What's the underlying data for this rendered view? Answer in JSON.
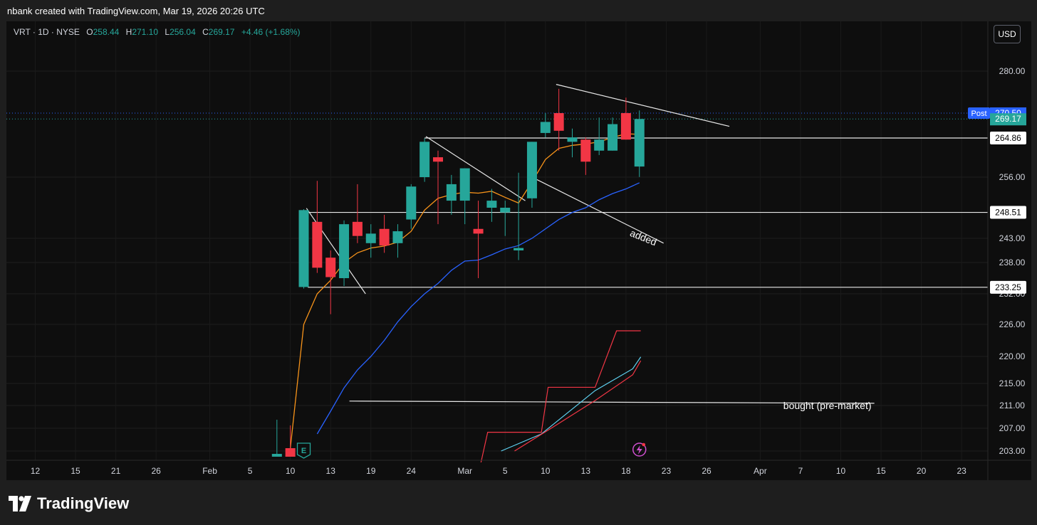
{
  "header": {
    "credit": "nbank created with TradingView.com, Mar 19, 2026 20:26 UTC"
  },
  "legend": {
    "symbol": "VRT · 1D · NYSE",
    "o_label": "O",
    "o_value": "258.44",
    "h_label": "H",
    "h_value": "271.10",
    "l_label": "L",
    "l_value": "256.04",
    "c_label": "C",
    "c_value": "269.17",
    "change": "+4.46 (+1.68%)"
  },
  "currency_button": "USD",
  "footer": {
    "brand": "TradingView"
  },
  "colors": {
    "up": "#26a69a",
    "down": "#f23645",
    "ema_fast": "#f7931a",
    "ema_slow": "#2962ff",
    "post_badge": "#2962ff",
    "trail_red": "#f23645",
    "trail_cyan": "#5fd3f3"
  },
  "icons": {
    "earnings": "earnings-e-icon",
    "flash": "lightning-icon",
    "logo": "tradingview-logo-icon"
  },
  "chart_data": {
    "type": "candlestick",
    "symbol": "VRT",
    "interval": "1D",
    "exchange": "NYSE",
    "ylim": [
      202,
      285
    ],
    "y_ticks": [
      "280.00",
      "256.00",
      "243.00",
      "238.00",
      "232.00",
      "226.00",
      "220.00",
      "215.00",
      "211.00",
      "207.00",
      "203.00"
    ],
    "y_tick_values": [
      280,
      256,
      243,
      238,
      232,
      226,
      220,
      215,
      211,
      207,
      203
    ],
    "x_ticks": [
      {
        "label": "12",
        "slot": 0
      },
      {
        "label": "15",
        "slot": 3
      },
      {
        "label": "21",
        "slot": 6
      },
      {
        "label": "26",
        "slot": 9
      },
      {
        "label": "Feb",
        "slot": 13
      },
      {
        "label": "5",
        "slot": 16
      },
      {
        "label": "10",
        "slot": 19
      },
      {
        "label": "13",
        "slot": 22
      },
      {
        "label": "19",
        "slot": 25
      },
      {
        "label": "24",
        "slot": 28
      },
      {
        "label": "Mar",
        "slot": 32
      },
      {
        "label": "5",
        "slot": 35
      },
      {
        "label": "10",
        "slot": 38
      },
      {
        "label": "13",
        "slot": 41
      },
      {
        "label": "18",
        "slot": 44
      },
      {
        "label": "23",
        "slot": 47
      },
      {
        "label": "26",
        "slot": 50
      },
      {
        "label": "Apr",
        "slot": 54
      },
      {
        "label": "7",
        "slot": 57
      },
      {
        "label": "10",
        "slot": 60
      },
      {
        "label": "15",
        "slot": 63
      },
      {
        "label": "20",
        "slot": 66
      },
      {
        "label": "23",
        "slot": 69
      }
    ],
    "candles": [
      {
        "slot": 18,
        "o": 202.0,
        "h": 208.5,
        "l": 202.0,
        "c": 202.5
      },
      {
        "slot": 19,
        "o": 203.5,
        "h": 207.5,
        "l": 202.0,
        "c": 202.0
      },
      {
        "slot": 20,
        "o": 233.3,
        "h": 249.2,
        "l": 233.0,
        "c": 249.0
      },
      {
        "slot": 21,
        "o": 246.5,
        "h": 255.2,
        "l": 236.0,
        "c": 237.0
      },
      {
        "slot": 22,
        "o": 239.0,
        "h": 240.5,
        "l": 228.0,
        "c": 235.2
      },
      {
        "slot": 23,
        "o": 235.0,
        "h": 246.8,
        "l": 233.5,
        "c": 246.0
      },
      {
        "slot": 24,
        "o": 246.5,
        "h": 254.5,
        "l": 242.0,
        "c": 243.5
      },
      {
        "slot": 25,
        "o": 242.0,
        "h": 246.0,
        "l": 239.0,
        "c": 244.0
      },
      {
        "slot": 26,
        "o": 245.0,
        "h": 248.0,
        "l": 240.0,
        "c": 241.5
      },
      {
        "slot": 27,
        "o": 242.0,
        "h": 246.0,
        "l": 239.0,
        "c": 244.5
      },
      {
        "slot": 28,
        "o": 247.0,
        "h": 254.5,
        "l": 245.0,
        "c": 254.0
      },
      {
        "slot": 29,
        "o": 256.0,
        "h": 264.8,
        "l": 255.0,
        "c": 264.0
      },
      {
        "slot": 30,
        "o": 260.5,
        "h": 262.0,
        "l": 246.0,
        "c": 259.5
      },
      {
        "slot": 31,
        "o": 251.0,
        "h": 256.5,
        "l": 248.0,
        "c": 254.5
      },
      {
        "slot": 32,
        "o": 251.0,
        "h": 258.0,
        "l": 246.0,
        "c": 258.0
      },
      {
        "slot": 33,
        "o": 245.0,
        "h": 251.0,
        "l": 235.0,
        "c": 244.0
      },
      {
        "slot": 34,
        "o": 249.5,
        "h": 253.5,
        "l": 246.5,
        "c": 251.0
      },
      {
        "slot": 35,
        "o": 248.5,
        "h": 251.0,
        "l": 243.5,
        "c": 249.5
      },
      {
        "slot": 36,
        "o": 240.5,
        "h": 257.0,
        "l": 238.5,
        "c": 241.0
      },
      {
        "slot": 37,
        "o": 251.5,
        "h": 264.0,
        "l": 249.5,
        "c": 264.0
      },
      {
        "slot": 38,
        "o": 266.0,
        "h": 270.5,
        "l": 265.0,
        "c": 268.5
      },
      {
        "slot": 39,
        "o": 270.5,
        "h": 276.0,
        "l": 262.0,
        "c": 266.5
      },
      {
        "slot": 40,
        "o": 264.0,
        "h": 267.0,
        "l": 260.5,
        "c": 265.0
      },
      {
        "slot": 41,
        "o": 264.5,
        "h": 265.0,
        "l": 256.5,
        "c": 259.5
      },
      {
        "slot": 42,
        "o": 262.0,
        "h": 269.5,
        "l": 261.0,
        "c": 264.5
      },
      {
        "slot": 43,
        "o": 262.0,
        "h": 269.5,
        "l": 262.0,
        "c": 268.0
      },
      {
        "slot": 44,
        "o": 270.5,
        "h": 274.0,
        "l": 264.5,
        "c": 264.5
      },
      {
        "slot": 45,
        "o": 258.4,
        "h": 271.1,
        "l": 256.04,
        "c": 269.17
      }
    ],
    "ema_fast": [
      [
        19,
        203.5
      ],
      [
        20,
        226.0
      ],
      [
        21,
        232.0
      ],
      [
        22,
        234.6
      ],
      [
        23,
        238.0
      ],
      [
        24,
        240.0
      ],
      [
        25,
        241.0
      ],
      [
        26,
        241.4
      ],
      [
        27,
        242.2
      ],
      [
        28,
        244.5
      ],
      [
        29,
        249.0
      ],
      [
        30,
        251.5
      ],
      [
        31,
        252.3
      ],
      [
        32,
        252.8
      ],
      [
        33,
        252.6
      ],
      [
        34,
        253.0
      ],
      [
        35,
        251.7
      ],
      [
        36,
        250.5
      ],
      [
        37,
        255.0
      ],
      [
        38,
        260.0
      ],
      [
        39,
        262.5
      ],
      [
        40,
        263.2
      ],
      [
        41,
        263.5
      ],
      [
        42,
        264.0
      ],
      [
        43,
        265.0
      ],
      [
        44,
        265.8
      ],
      [
        45,
        265.7
      ]
    ],
    "ema_slow": [
      [
        21,
        206.0
      ],
      [
        22,
        210.0
      ],
      [
        23,
        214.2
      ],
      [
        24,
        217.5
      ],
      [
        25,
        220.0
      ],
      [
        26,
        223.0
      ],
      [
        27,
        226.5
      ],
      [
        28,
        229.5
      ],
      [
        29,
        232.0
      ],
      [
        30,
        234.0
      ],
      [
        31,
        236.5
      ],
      [
        32,
        238.3
      ],
      [
        33,
        238.5
      ],
      [
        34,
        239.6
      ],
      [
        35,
        240.8
      ],
      [
        36,
        241.5
      ],
      [
        37,
        243.0
      ],
      [
        38,
        245.0
      ],
      [
        39,
        247.0
      ],
      [
        40,
        248.5
      ],
      [
        41,
        249.5
      ],
      [
        42,
        251.2
      ],
      [
        43,
        252.5
      ],
      [
        44,
        253.5
      ],
      [
        45,
        254.8
      ]
    ],
    "horizontal_levels": [
      {
        "price": 264.86,
        "label": "264.86",
        "start_slot": 29.0
      },
      {
        "price": 248.51,
        "label": "248.51",
        "start_slot": 20.3
      },
      {
        "price": 233.25,
        "label": "233.25",
        "start_slot": 20.3
      }
    ],
    "price_badges": [
      {
        "price": 270.5,
        "label": "270.50",
        "tag": "Post",
        "kind": "post"
      },
      {
        "price": 269.17,
        "label": "269.17",
        "kind": "last"
      }
    ],
    "trendlines": [
      {
        "x1": 38.8,
        "y1": 277.0,
        "x2": 51.7,
        "y2": 267.5
      },
      {
        "x1": 20.2,
        "y1": 249.4,
        "x2": 24.6,
        "y2": 232.0
      },
      {
        "x1": 29.1,
        "y1": 265.2,
        "x2": 36.5,
        "y2": 251.0
      },
      {
        "x1": 37.0,
        "y1": 256.0,
        "x2": 46.8,
        "y2": 242.0
      },
      {
        "x1": 23.4,
        "y1": 211.8,
        "x2": 62.5,
        "y2": 211.4
      }
    ],
    "annotations": [
      {
        "text": "added",
        "slot": 45.2,
        "price": 242.5,
        "rotate": 22
      },
      {
        "text": "bought (pre-market)",
        "slot": 59.0,
        "price": 210.4,
        "rotate": 0
      }
    ],
    "trail_red_step": [
      [
        33.2,
        201
      ],
      [
        33.7,
        206.3
      ],
      [
        37.7,
        206.3
      ],
      [
        38.2,
        214.3
      ],
      [
        41.7,
        214.3
      ],
      [
        43.3,
        224.8
      ],
      [
        45.1,
        224.8
      ]
    ],
    "trail_cyan": [
      [
        34.7,
        203
      ],
      [
        37.7,
        206.0
      ],
      [
        41.7,
        213.7
      ],
      [
        44.5,
        217.7
      ],
      [
        45.1,
        219.9
      ]
    ],
    "trail_red_diag": [
      [
        35.7,
        203
      ],
      [
        38.7,
        207.4
      ],
      [
        41.7,
        211.9
      ],
      [
        44.5,
        216.6
      ],
      [
        45.1,
        219.2
      ]
    ],
    "events": [
      {
        "type": "earnings",
        "label": "E",
        "slot": 20.0
      },
      {
        "type": "flash",
        "slot": 45.0
      }
    ]
  }
}
